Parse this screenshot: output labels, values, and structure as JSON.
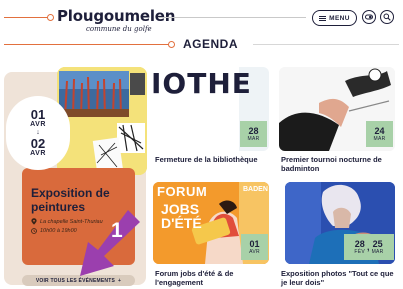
{
  "header": {
    "logo_name": "Plougoumelen",
    "logo_sub": "commune du golfe",
    "menu_label": "MENU",
    "icons": [
      "menu-lines-icon",
      "switch-icon",
      "search-icon"
    ]
  },
  "section": {
    "title": "AGENDA"
  },
  "featured": {
    "start_day": "01",
    "start_month": "AVR",
    "arrow": "↓",
    "end_day": "02",
    "end_month": "AVR",
    "title": "Exposition de peintures",
    "place": "La chapelle Saint-Thuriau",
    "time": "10h00 à 19h00",
    "all_events_label": "VOIR TOUS LES ÉVÉNEMENTS"
  },
  "annotation": {
    "number": "1",
    "color": "#9b3fae"
  },
  "cards": [
    {
      "title": "Fermeture de la bibliothèque",
      "day": "28",
      "month": "MAR",
      "image_text": "IOTHE"
    },
    {
      "title": "Premier tournoi nocturne de badminton",
      "day": "24",
      "month": "MAR"
    },
    {
      "title": "Forum jobs d'été & de l'engagement",
      "day": "01",
      "month": "AVR",
      "image_text_1": "FORUM",
      "image_text_2": "JOBS D'ÉTÉ",
      "image_text_3": "BADEN"
    },
    {
      "title": "Exposition photos \"Tout ce que je leur dois\"",
      "day_start": "28",
      "month_start": "FÉV",
      "separator": ",",
      "day_end": "25",
      "month_end": "MAR"
    }
  ],
  "colors": {
    "navy": "#1e1f3a",
    "orange": "#e2703e",
    "tag_green": "#a8d1a8",
    "feature_orange": "#d96a3c",
    "beige": "#efe3d8"
  }
}
